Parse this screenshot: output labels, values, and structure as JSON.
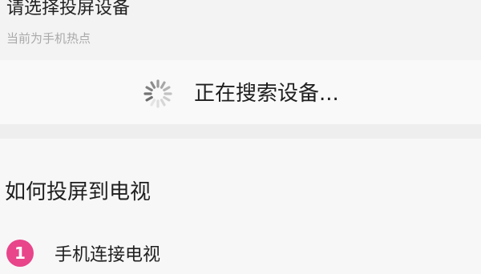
{
  "header": {
    "title": "请选择投屏设备",
    "subtitle": "当前为手机热点"
  },
  "search": {
    "status_text": "正在搜索设备...",
    "spinner_icon": "loading-spinner-icon"
  },
  "howto": {
    "title": "如何投屏到电视",
    "steps": [
      {
        "number": "1",
        "label": "手机连接电视"
      }
    ]
  },
  "colors": {
    "accent": "#e8458b",
    "background": "#f3f3f3",
    "subtitle": "#a9a9a9"
  }
}
